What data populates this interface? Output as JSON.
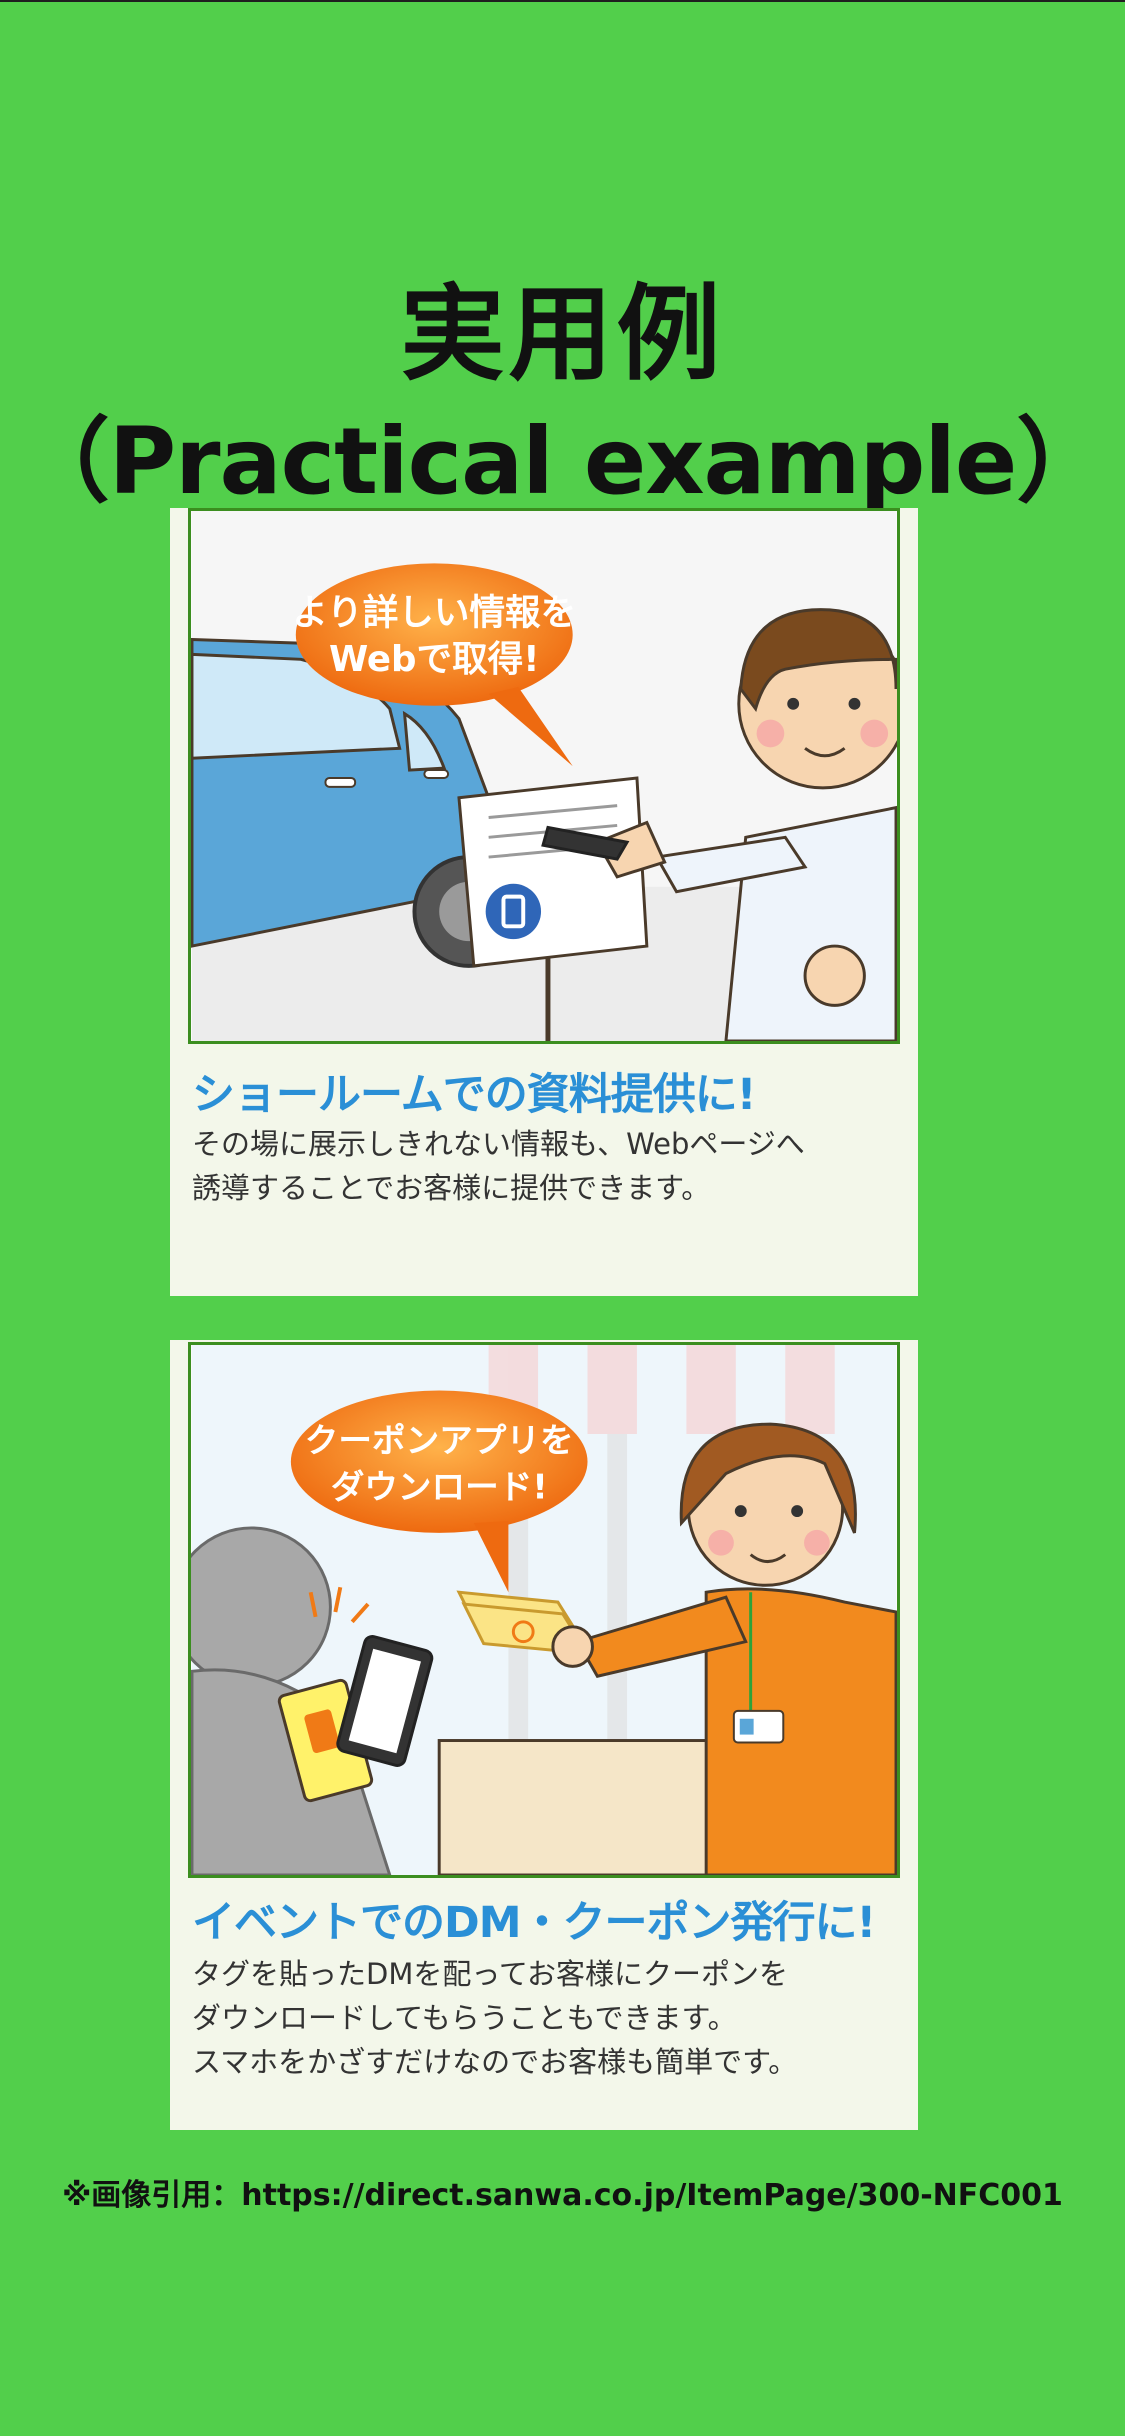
{
  "title": {
    "ja": "実用例",
    "en": "（Practical example）"
  },
  "cards": [
    {
      "bubble_line1": "より詳しい情報を",
      "bubble_line2": "Webで取得!",
      "heading": "ショールームでの資料提供に!",
      "lines": [
        "その場に展示しきれない情報も、Webページへ",
        "誘導することでお客様に提供できます。"
      ]
    },
    {
      "bubble_line1": "クーポンアプリを",
      "bubble_line2": "ダウンロード!",
      "heading": "イベントでのDM・クーポン発行に!",
      "lines": [
        "タグを貼ったDMを配ってお客様にクーポンを",
        "ダウンロードしてもらうこともできます。",
        "スマホをかざすだけなのでお客様も簡単です。"
      ]
    }
  ],
  "credit": "※画像引用：https://direct.sanwa.co.jp/ItemPage/300-NFC001",
  "colors": {
    "background": "#52cf4b",
    "heading": "#2a8fd6",
    "bubble": "#f07a16",
    "border": "#3b8e1f"
  }
}
